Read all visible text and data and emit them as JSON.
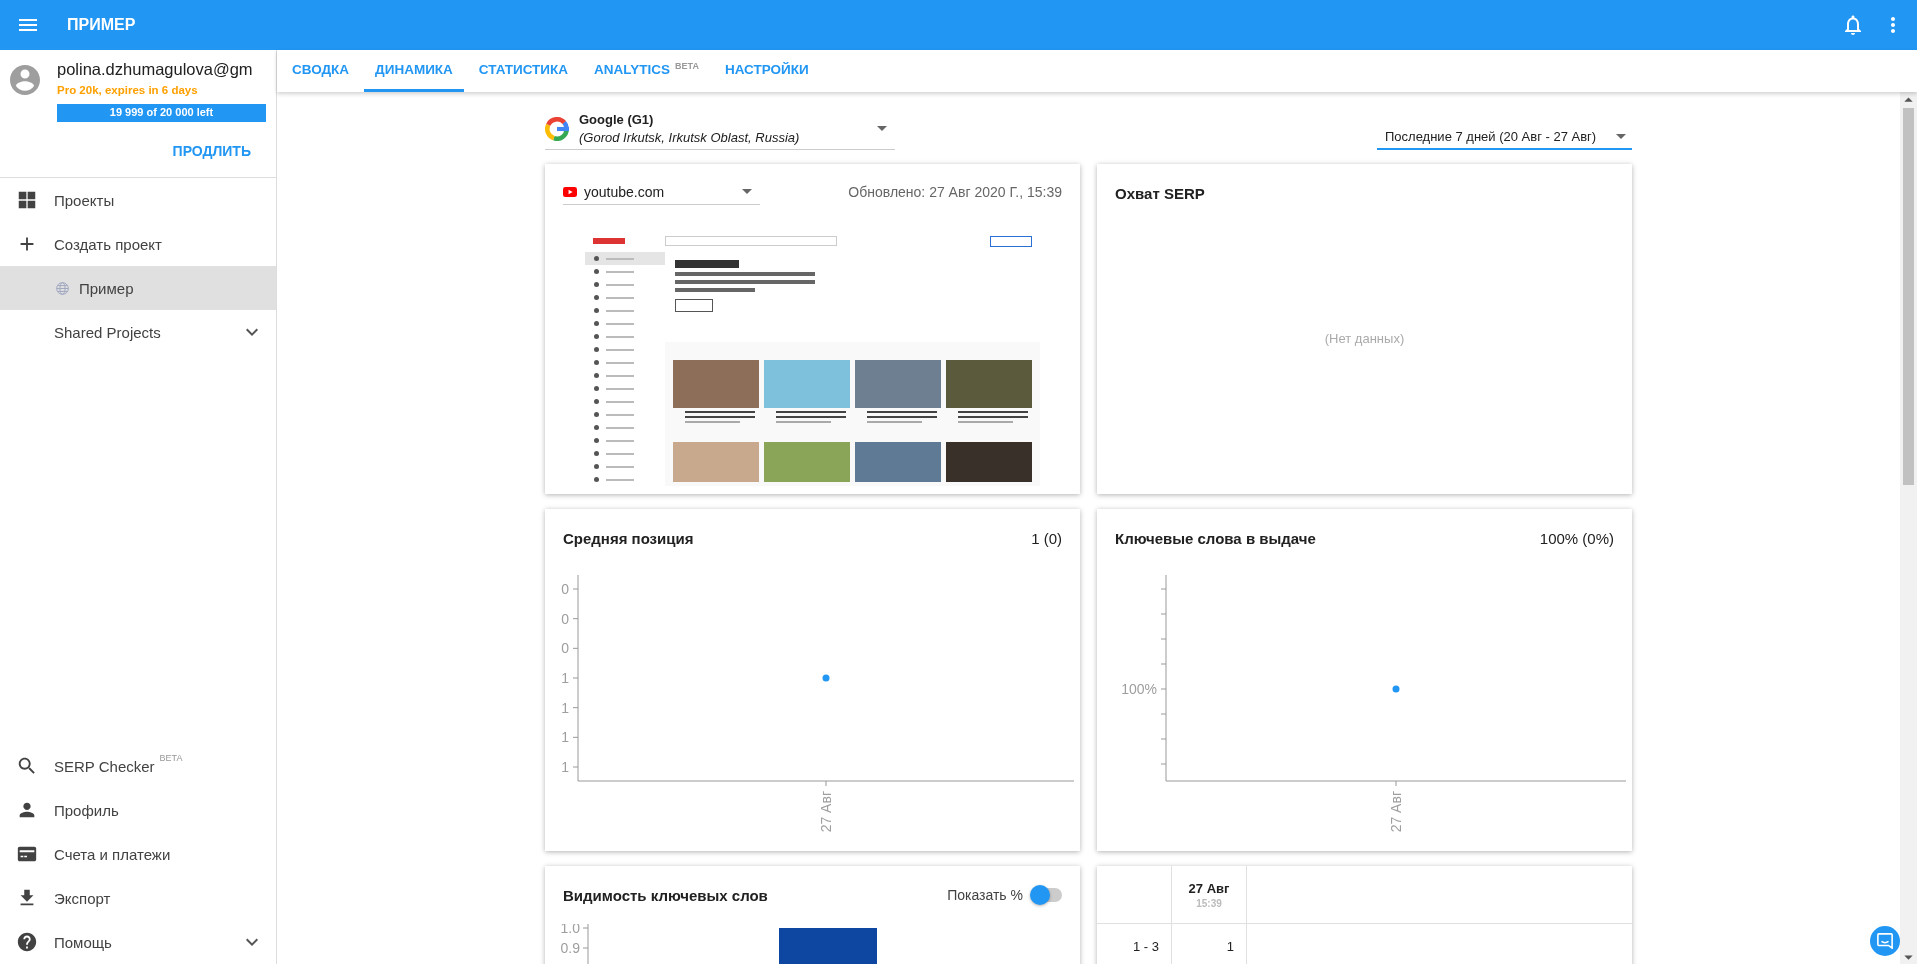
{
  "app_bar": {
    "title": "ПРИМЕР"
  },
  "account": {
    "email": "polina.dzhumagulova@gm",
    "plan": "Pro 20k, expires in 6 days",
    "quota": {
      "text": "19 999 of 20 000 left",
      "level": 1
    },
    "renew_button": "ПРОДЛИТЬ"
  },
  "sidebar": {
    "items": [
      {
        "kind": "projects",
        "label": "Проекты",
        "selected": false
      },
      {
        "kind": "create",
        "label": "Создать проект",
        "selected": false
      },
      {
        "kind": "project",
        "label": "Пример",
        "selected": true
      },
      {
        "kind": "group",
        "label": "Shared Projects",
        "selected": false,
        "expanded": false
      }
    ],
    "bottom_items": [
      {
        "kind": "search",
        "label": "SERP Checker",
        "badge": "BETA"
      },
      {
        "kind": "profile",
        "label": "Профиль"
      },
      {
        "kind": "billing",
        "label": "Счета и платежи"
      },
      {
        "kind": "export",
        "label": "Экспорт"
      },
      {
        "kind": "help",
        "label": "Помощь",
        "expanded": false
      }
    ]
  },
  "tabs": [
    {
      "label": "СВОДКА",
      "selected": false
    },
    {
      "label": "ДИНАМИКА",
      "selected": true
    },
    {
      "label": "СТАТИСТИКА",
      "selected": false
    },
    {
      "label": "ANALYTICS",
      "badge": "BETA",
      "selected": false
    },
    {
      "label": "НАСТРОЙКИ",
      "selected": false
    }
  ],
  "search_engine": {
    "name": "Google (G1)",
    "location": "(Gorod Irkutsk, Irkutsk Oblast, Russia)"
  },
  "period": {
    "value": "Последние 7 дней (20 Авг - 27 Авг)"
  },
  "site_card": {
    "site": "youtube.com",
    "updated": "Обновлено: 27 Авг 2020 Г., 15:39"
  },
  "serp_card": {
    "title": "Охват SERP",
    "empty": "(Нет данных)"
  },
  "position_card": {
    "title": "Средняя позиция",
    "summary": "1 (0)",
    "y_labels": [
      "0",
      "0",
      "0",
      "1",
      "1",
      "1",
      "1"
    ],
    "x_labels": [
      "27 Авг"
    ]
  },
  "keywords_card": {
    "title": "Ключевые слова в выдаче",
    "summary": "100% (0%)",
    "y_labels": [
      "100%"
    ],
    "x_labels": [
      "27 Авг"
    ]
  },
  "visibility_card": {
    "title": "Видимость ключевых слов",
    "toggle": {
      "label": "Показать %",
      "on": false
    },
    "y_labels": [
      "1.0",
      "0.9"
    ]
  },
  "positions_table": {
    "columns": [
      {
        "date": "27 Авг",
        "time": "15:39"
      }
    ],
    "rows": [
      {
        "range": "1 - 3",
        "values": [
          "1"
        ]
      }
    ]
  }
}
